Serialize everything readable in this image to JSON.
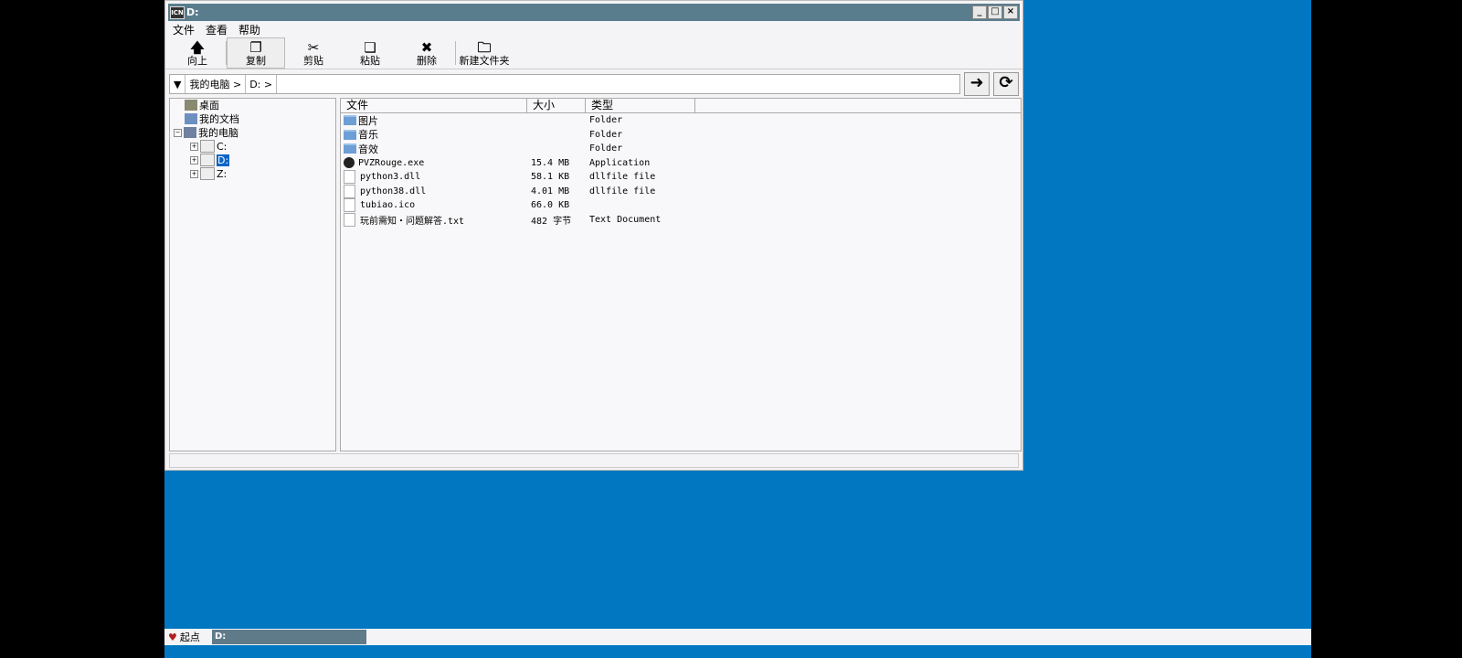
{
  "window": {
    "title": "D:",
    "buttons": [
      "_",
      "□",
      "×"
    ]
  },
  "menu": [
    "文件",
    "查看",
    "帮助"
  ],
  "toolbar": [
    {
      "label": "向上",
      "glyph": "🡅",
      "icon": "arrow-up-icon"
    },
    {
      "label": "复制",
      "glyph": "❐",
      "icon": "copy-icon"
    },
    {
      "label": "剪贴",
      "glyph": "✂",
      "icon": "cut-icon"
    },
    {
      "label": "粘贴",
      "glyph": "❏",
      "icon": "paste-icon"
    },
    {
      "label": "删除",
      "glyph": "✖",
      "icon": "delete-icon"
    },
    {
      "label": "新建文件夹",
      "glyph": "🗀",
      "icon": "new-folder-icon"
    }
  ],
  "address": {
    "crumbs": [
      "我的电脑 >",
      "D: >"
    ],
    "go": "➜",
    "refresh": "⟳"
  },
  "tree": [
    {
      "label": "桌面"
    },
    {
      "label": "我的文档"
    },
    {
      "label": "我的电脑"
    },
    {
      "label": "C:"
    },
    {
      "label": "D:"
    },
    {
      "label": "Z:"
    }
  ],
  "list": {
    "headers": [
      "文件",
      "大小",
      "类型"
    ],
    "rows": [
      {
        "name": "图片",
        "size": "",
        "type": "Folder",
        "kind": "folder"
      },
      {
        "name": "音乐",
        "size": "",
        "type": "Folder",
        "kind": "folder"
      },
      {
        "name": "音效",
        "size": "",
        "type": "Folder",
        "kind": "folder"
      },
      {
        "name": "PVZRouge.exe",
        "size": "15.4 MB",
        "type": "Application",
        "kind": "app"
      },
      {
        "name": "python3.dll",
        "size": "58.1 KB",
        "type": "dllfile file",
        "kind": "file"
      },
      {
        "name": "python38.dll",
        "size": "4.01 MB",
        "type": "dllfile file",
        "kind": "file"
      },
      {
        "name": "tubiao.ico",
        "size": "66.0 KB",
        "type": "",
        "kind": "file"
      },
      {
        "name": "玩前需知・问题解答.txt",
        "size": "482 字节",
        "type": "Text Document",
        "kind": "file"
      }
    ]
  },
  "taskbar": {
    "start": "起点",
    "task": "D:"
  },
  "colors": {
    "desktop": "#0077c0",
    "titlebar": "#5a7d8e",
    "selection": "#0a64c8"
  }
}
